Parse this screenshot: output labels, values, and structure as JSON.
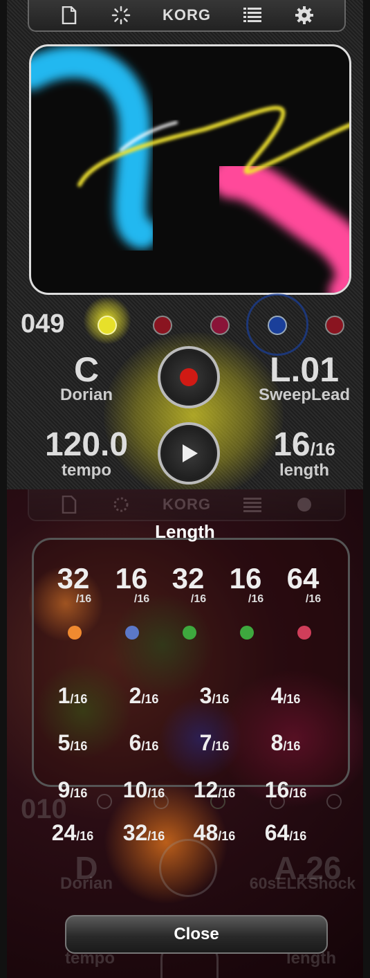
{
  "top": {
    "toolbar": {
      "icons": [
        "new-file-icon",
        "load-icon",
        "list-icon",
        "settings-icon"
      ],
      "logo": "KORG"
    },
    "program_number": "049",
    "key": {
      "value": "C",
      "label": "Dorian"
    },
    "sound": {
      "value": "L.01",
      "label": "SweepLead"
    },
    "tempo": {
      "value": "120.0",
      "label": "tempo"
    },
    "length": {
      "value": "16",
      "unit": "/16",
      "label": "length"
    },
    "track_colors": [
      "#e7e02a",
      "#8a1420",
      "#8a1438",
      "#1a3f9a",
      "#8a1420"
    ],
    "accent": "#e7e02a"
  },
  "bottom": {
    "modal_title": "Length",
    "presets": [
      {
        "value": "32",
        "unit": "/16",
        "color": "#f08a30"
      },
      {
        "value": "16",
        "unit": "/16",
        "color": "#5b78c8"
      },
      {
        "value": "32",
        "unit": "/16",
        "color": "#3ea83e"
      },
      {
        "value": "16",
        "unit": "/16",
        "color": "#3ea83e"
      },
      {
        "value": "64",
        "unit": "/16",
        "color": "#d03e5a"
      }
    ],
    "options": [
      {
        "value": "1",
        "unit": "/16"
      },
      {
        "value": "2",
        "unit": "/16"
      },
      {
        "value": "3",
        "unit": "/16"
      },
      {
        "value": "4",
        "unit": "/16"
      },
      {
        "value": "5",
        "unit": "/16"
      },
      {
        "value": "6",
        "unit": "/16"
      },
      {
        "value": "7",
        "unit": "/16"
      },
      {
        "value": "8",
        "unit": "/16"
      },
      {
        "value": "9",
        "unit": "/16"
      },
      {
        "value": "10",
        "unit": "/16"
      },
      {
        "value": "12",
        "unit": "/16"
      },
      {
        "value": "16",
        "unit": "/16"
      },
      {
        "value": "24",
        "unit": "/16"
      },
      {
        "value": "32",
        "unit": "/16"
      },
      {
        "value": "48",
        "unit": "/16"
      },
      {
        "value": "64",
        "unit": "/16"
      }
    ],
    "background": {
      "program_number": "010",
      "key": {
        "value": "D",
        "label": "Dorian"
      },
      "sound": {
        "value": "A.26",
        "label": "60sELKShock"
      },
      "tempo_label": "tempo",
      "length_label": "length"
    },
    "close_label": "Close"
  }
}
